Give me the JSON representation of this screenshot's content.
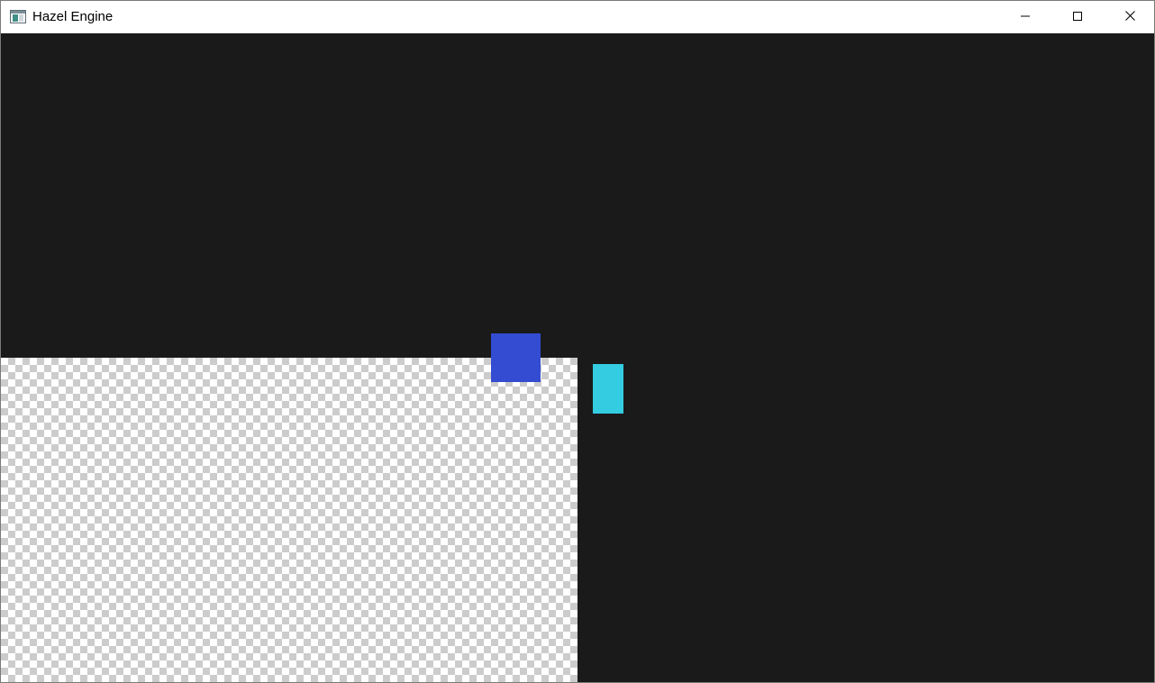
{
  "window": {
    "title": "Hazel Engine",
    "icons": {
      "app": "app-window-icon",
      "minimize": "minimize-icon",
      "maximize": "maximize-icon",
      "close": "close-icon"
    }
  },
  "scene": {
    "clear_color": "#1a1a1a",
    "checkerboard_colors": [
      "#ffffff",
      "#cccccc"
    ],
    "quads": [
      {
        "name": "blue-quad",
        "color": "#334cd1"
      },
      {
        "name": "cyan-quad",
        "color": "#33cce0"
      }
    ]
  }
}
